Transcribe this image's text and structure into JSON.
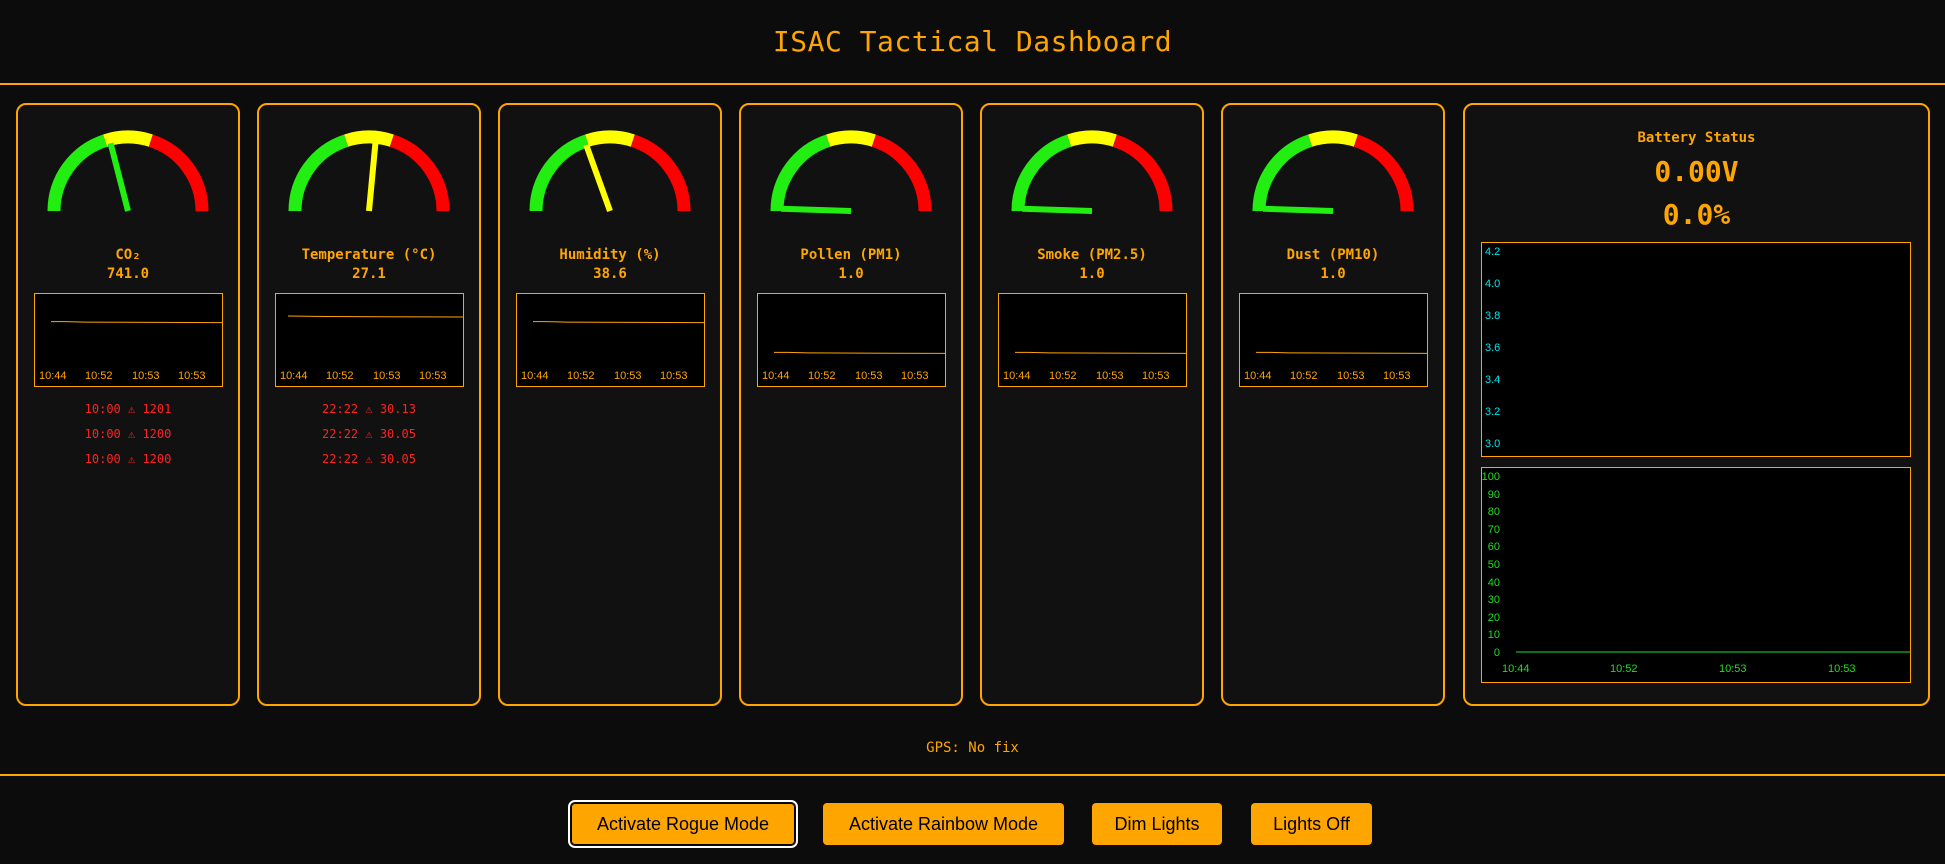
{
  "title": "ISAC Tactical Dashboard",
  "colors": {
    "accent": "#ffa500",
    "alert": "#ff2222",
    "gauge_green": "#22ee11",
    "gauge_yellow": "#ffff00",
    "gauge_red": "#ff0000",
    "battery_axis": "#00e5ee",
    "percent_axis": "#22dd22"
  },
  "time_ticks": [
    "10:44",
    "10:52",
    "10:53",
    "10:53"
  ],
  "sensors": [
    {
      "label": "CO₂",
      "value": "741.0",
      "gauge_fraction": 0.42,
      "needle_color": "#22ee11",
      "spark_level": 0.35,
      "alerts": [
        "10:00 ⚠ 1201",
        "10:00 ⚠ 1200",
        "10:00 ⚠ 1200"
      ]
    },
    {
      "label": "Temperature (°C)",
      "value": "27.1",
      "gauge_fraction": 0.53,
      "needle_color": "#ffff00",
      "spark_level": 0.25,
      "alerts": [
        "22:22 ⚠ 30.13",
        "22:22 ⚠ 30.05",
        "22:22 ⚠ 30.05"
      ]
    },
    {
      "label": "Humidity (%)",
      "value": "38.6",
      "gauge_fraction": 0.39,
      "needle_color": "#ffff00",
      "spark_level": 0.35,
      "alerts": []
    },
    {
      "label": "Pollen (PM1)",
      "value": "1.0",
      "gauge_fraction": 0.01,
      "needle_color": "#22ee11",
      "spark_level": 0.9,
      "alerts": []
    },
    {
      "label": "Smoke (PM2.5)",
      "value": "1.0",
      "gauge_fraction": 0.01,
      "needle_color": "#22ee11",
      "spark_level": 0.9,
      "alerts": []
    },
    {
      "label": "Dust (PM10)",
      "value": "1.0",
      "gauge_fraction": 0.01,
      "needle_color": "#22ee11",
      "spark_level": 0.9,
      "alerts": []
    }
  ],
  "battery": {
    "title": "Battery Status",
    "voltage": "0.00V",
    "percent": "0.0%",
    "voltage_axis": [
      "4.2",
      "4.0",
      "3.8",
      "3.6",
      "3.4",
      "3.2",
      "3.0"
    ],
    "percent_axis": [
      "100",
      "90",
      "80",
      "70",
      "60",
      "50",
      "40",
      "30",
      "20",
      "10",
      "0"
    ],
    "percent_series": [
      0,
      0,
      0,
      0
    ]
  },
  "gps": "GPS: No fix",
  "buttons": [
    "Activate Rogue Mode",
    "Activate Rainbow Mode",
    "Dim Lights",
    "Lights Off"
  ]
}
